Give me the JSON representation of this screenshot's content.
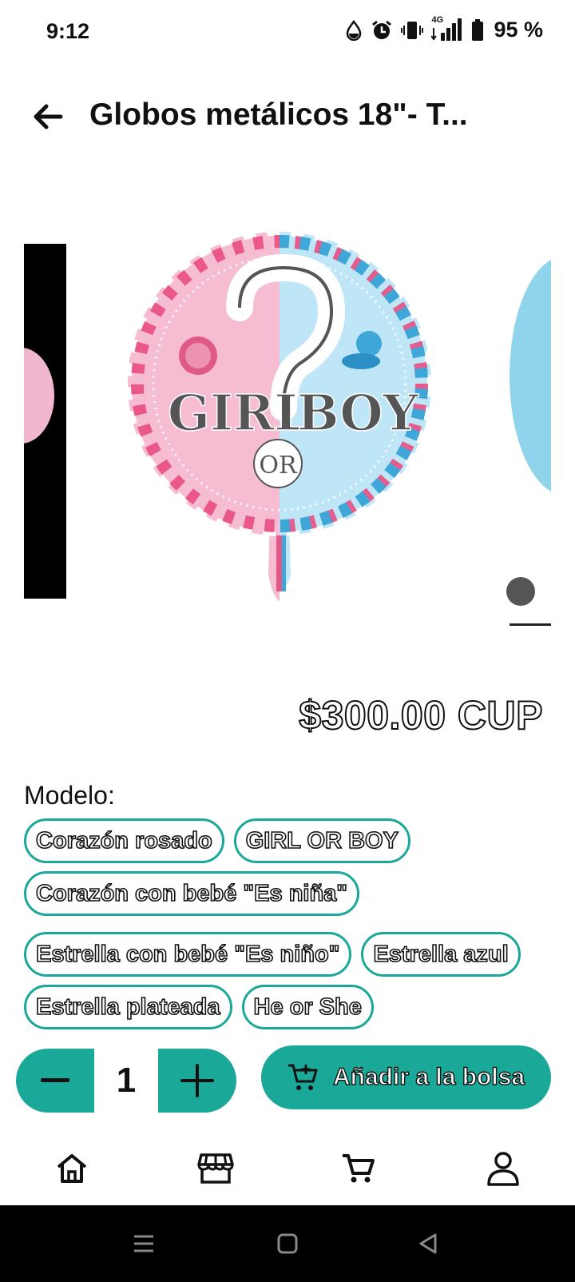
{
  "status_bar": {
    "time": "9:12",
    "network": "4G",
    "battery": "95 %"
  },
  "header": {
    "title": "Globos metálicos 18\"- T..."
  },
  "product_image": {
    "text_girl": "GIRL",
    "text_or": "OR",
    "text_boy": "BOY"
  },
  "product": {
    "price": "$300.00 CUP",
    "model_label": "Modelo:",
    "models": [
      "Corazón rosado",
      "GIRL OR BOY",
      "Corazón con bebé \"Es niña\"",
      "Estrella con bebé \"Es niño\"",
      "Estrella azul",
      "Estrella plateada",
      "He or She"
    ]
  },
  "cart": {
    "quantity": "1",
    "add_label": "Añadir a la bolsa"
  },
  "colors": {
    "accent": "#1aa899",
    "pink": "#f6bcd2",
    "blue": "#bfe6f7"
  },
  "icons": [
    "arrow-left-icon",
    "minus-icon",
    "plus-icon",
    "cart-add-icon",
    "home-icon",
    "store-icon",
    "cart-icon",
    "user-icon"
  ]
}
